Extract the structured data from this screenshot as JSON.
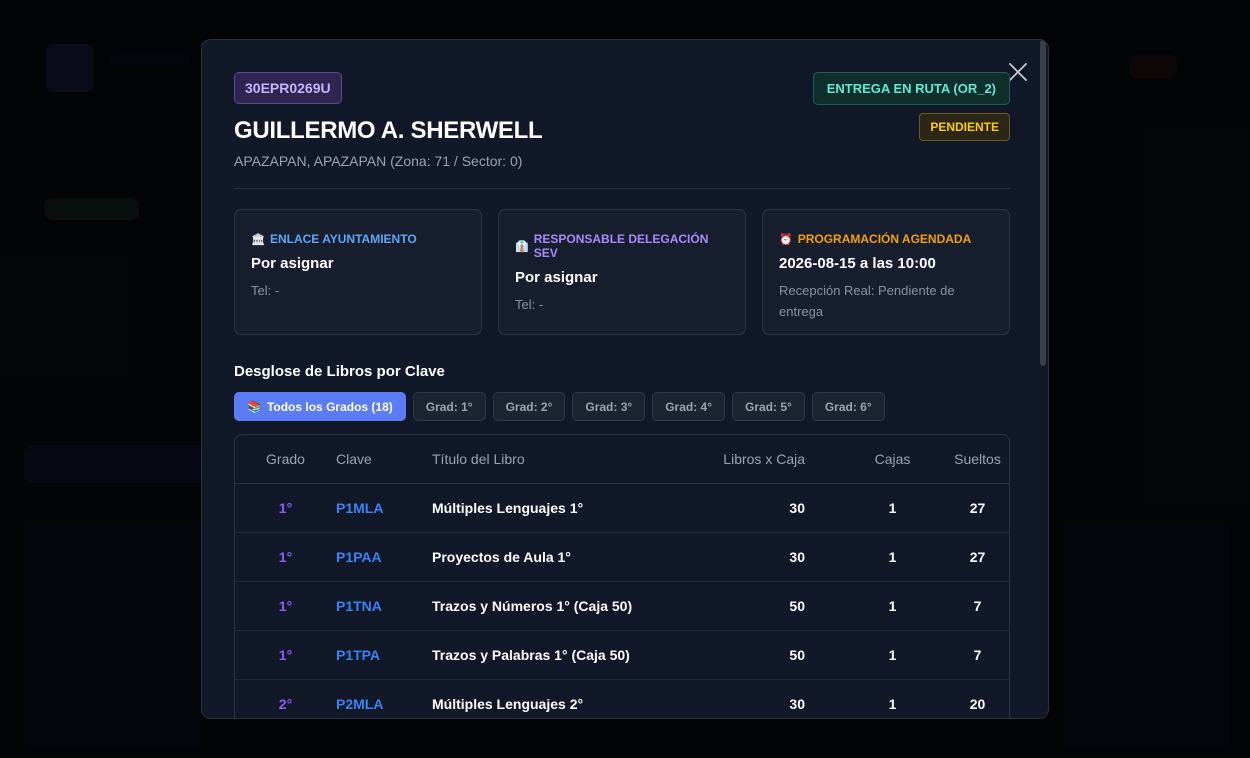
{
  "modal": {
    "school_code": "30EPR0269U",
    "status_route": "ENTREGA EN RUTA (OR_2)",
    "status_pending": "PENDIENTE",
    "school_name": "GUILLERMO A. SHERWELL",
    "location": "APAZAPAN, APAZAPAN (Zona: 71 / Sector: 0)"
  },
  "cards": [
    {
      "icon": "🏛",
      "title": "ENLACE AYUNTAMIENTO",
      "color": "#60a5fa",
      "main": "Por asignar",
      "sub": "Tel: -"
    },
    {
      "icon": "👔",
      "title": "RESPONSABLE DELEGACIÓN SEV",
      "color": "#a78bfa",
      "main": "Por asignar",
      "sub": "Tel: -"
    },
    {
      "icon": "⏰",
      "title": "PROGRAMACIÓN AGENDADA",
      "color": "#f59e0b",
      "main": "2026-08-15 a las 10:00",
      "sub": "Recepción Real: Pendiente de entrega"
    }
  ],
  "section_title": "Desglose de Libros por Clave",
  "filters": [
    {
      "label": "Todos los Grados (18)",
      "icon": "📚"
    },
    {
      "label": "Grad: 1°"
    },
    {
      "label": "Grad: 2°"
    },
    {
      "label": "Grad: 3°"
    },
    {
      "label": "Grad: 4°"
    },
    {
      "label": "Grad: 5°"
    },
    {
      "label": "Grad: 6°"
    }
  ],
  "table": {
    "headers": [
      "Grado",
      "Clave",
      "Título del Libro",
      "Libros x Caja",
      "Cajas",
      "Sueltos"
    ],
    "rows": [
      {
        "grade": "1°",
        "key": "P1MLA",
        "title": "Múltiples Lenguajes 1°",
        "per_box": "30",
        "boxes": "1",
        "loose": "27"
      },
      {
        "grade": "1°",
        "key": "P1PAA",
        "title": "Proyectos de Aula 1°",
        "per_box": "30",
        "boxes": "1",
        "loose": "27"
      },
      {
        "grade": "1°",
        "key": "P1TNA",
        "title": "Trazos y Números 1° (Caja 50)",
        "per_box": "50",
        "boxes": "1",
        "loose": "7"
      },
      {
        "grade": "1°",
        "key": "P1TPA",
        "title": "Trazos y Palabras 1° (Caja 50)",
        "per_box": "50",
        "boxes": "1",
        "loose": "7"
      },
      {
        "grade": "2°",
        "key": "P2MLA",
        "title": "Múltiples Lenguajes 2°",
        "per_box": "30",
        "boxes": "1",
        "loose": "20"
      }
    ]
  }
}
